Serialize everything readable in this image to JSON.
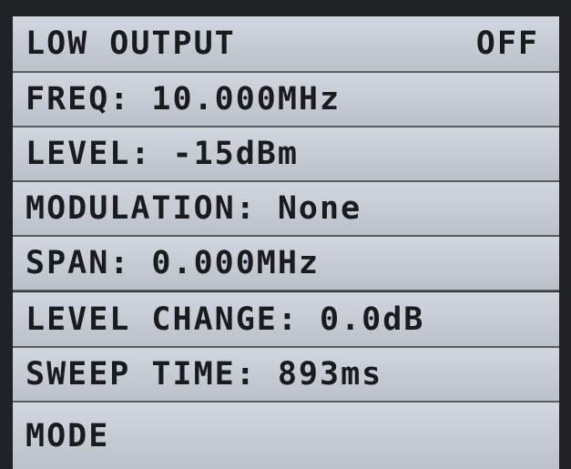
{
  "menu": {
    "rows": [
      {
        "label": "LOW OUTPUT",
        "value": "OFF"
      },
      {
        "label": "FREQ: 10.000MHz"
      },
      {
        "label": "LEVEL: -15dBm"
      },
      {
        "label": "MODULATION: None"
      },
      {
        "label": "SPAN: 0.000MHz"
      },
      {
        "label": "LEVEL CHANGE: 0.0dB"
      },
      {
        "label": "SWEEP TIME: 893ms"
      },
      {
        "label": "MODE"
      }
    ]
  }
}
